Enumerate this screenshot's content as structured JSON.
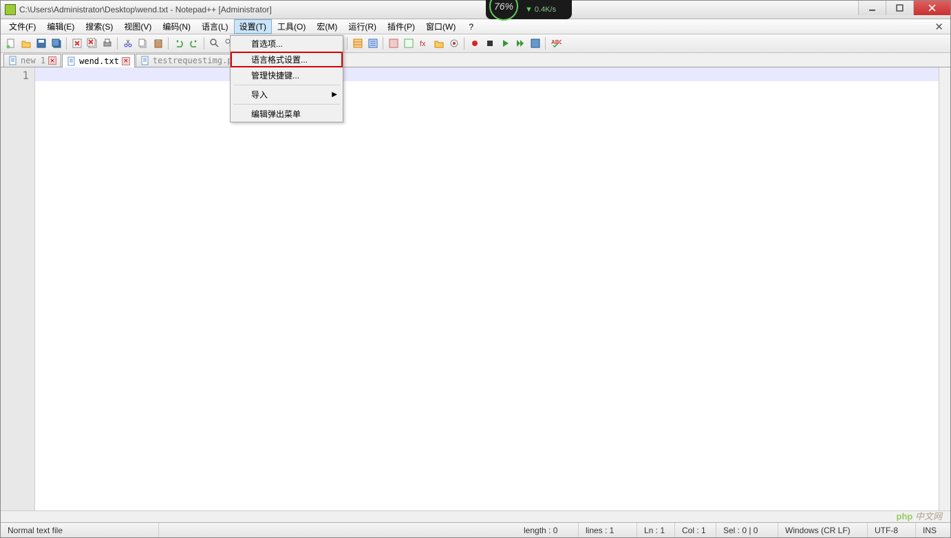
{
  "title": "C:\\Users\\Administrator\\Desktop\\wend.txt - Notepad++ [Administrator]",
  "overlay": {
    "percent": "76%",
    "speed": "0.4K/s"
  },
  "menu": {
    "file": "文件(F)",
    "edit": "编辑(E)",
    "search": "搜索(S)",
    "view": "视图(V)",
    "encoding": "编码(N)",
    "language": "语言(L)",
    "settings": "设置(T)",
    "tools": "工具(O)",
    "macro": "宏(M)",
    "run": "运行(R)",
    "plugins": "插件(P)",
    "window": "窗口(W)",
    "help": "?"
  },
  "dropdown": {
    "preferences": "首选项...",
    "style_config": "语言格式设置...",
    "shortcut": "管理快捷键...",
    "import": "导入",
    "popup": "编辑弹出菜单"
  },
  "tabs": [
    {
      "label": "new 1",
      "active": false
    },
    {
      "label": "wend.txt",
      "active": true
    },
    {
      "label": "testrequestimg.py",
      "active": false
    }
  ],
  "gutter": {
    "line1": "1"
  },
  "status": {
    "type": "Normal text file",
    "length": "length : 0",
    "lines": "lines : 1",
    "ln": "Ln : 1",
    "col": "Col : 1",
    "sel": "Sel : 0 | 0",
    "eol": "Windows (CR LF)",
    "enc": "UTF-8",
    "mode": "INS"
  },
  "watermark": "php 中文网"
}
